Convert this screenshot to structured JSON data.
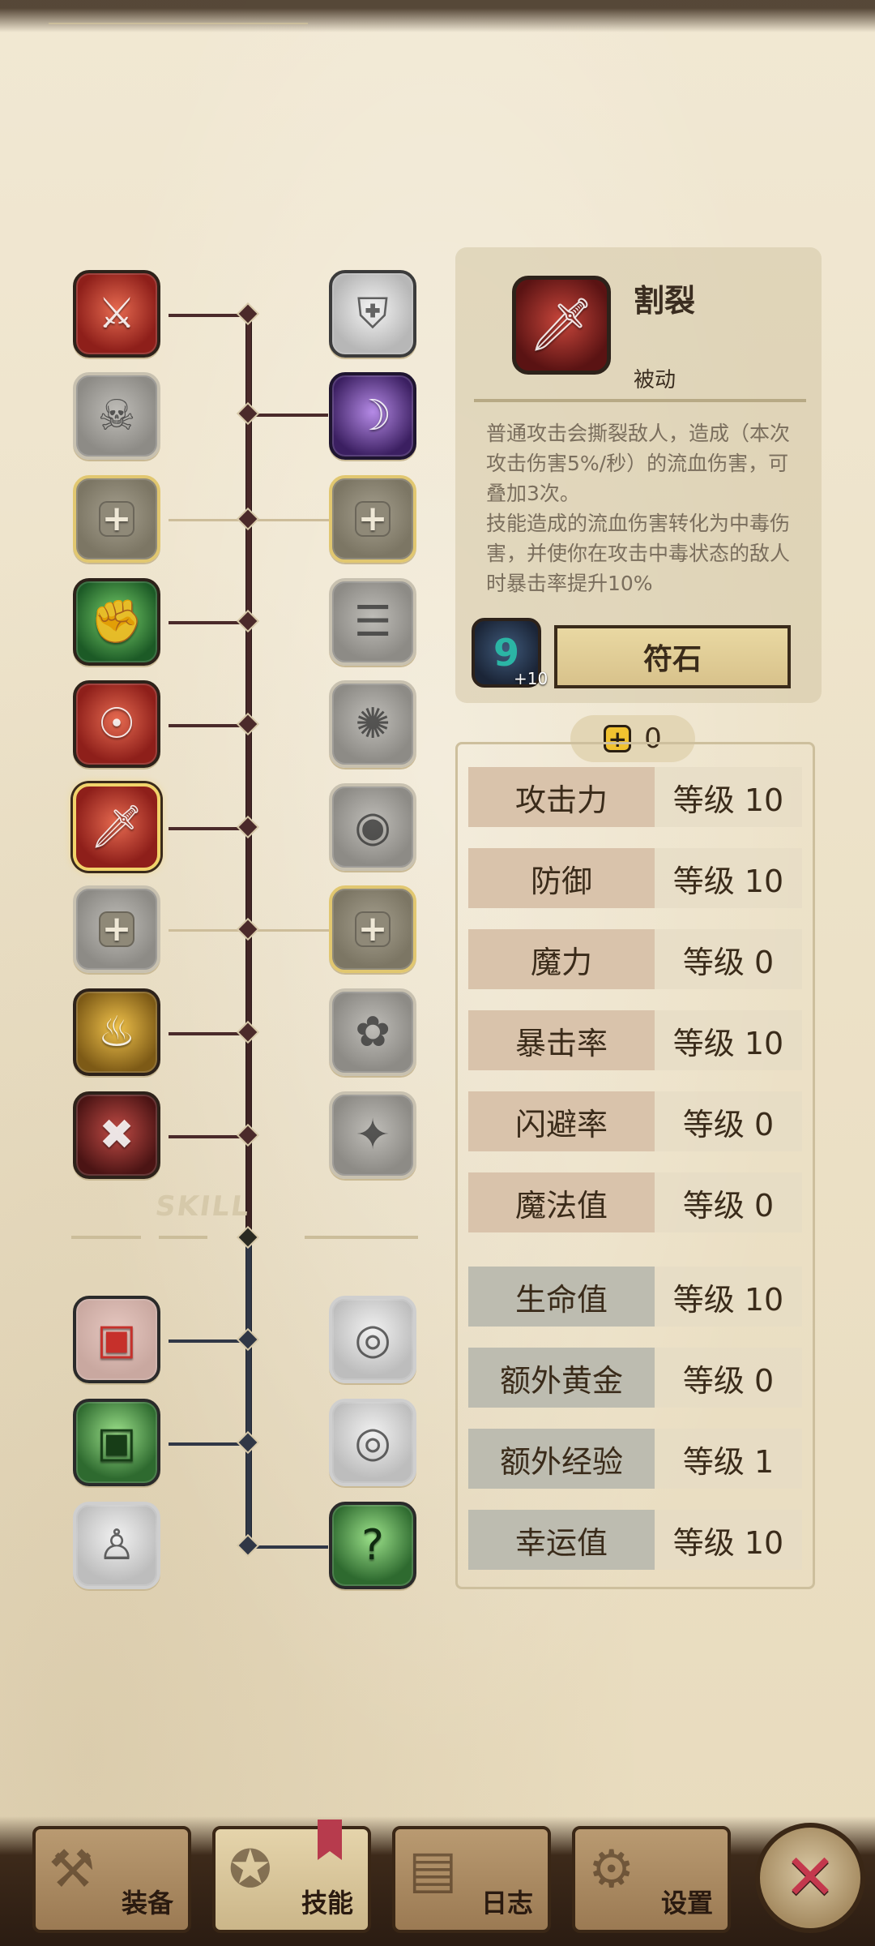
{
  "skill_tree": {
    "section_label": "SKILL",
    "left_column": [
      {
        "name": "slash-skill",
        "icon": "claw-slash-icon",
        "state": "unlocked",
        "color": "red"
      },
      {
        "name": "kick-skill",
        "icon": "kick-icon",
        "state": "locked",
        "color": "gray"
      },
      {
        "name": "empty-slot-left-1",
        "icon": "plus-slot-icon",
        "state": "slot",
        "color": "gold-outline"
      },
      {
        "name": "strength-skill",
        "icon": "muscle-icon",
        "state": "unlocked",
        "color": "green"
      },
      {
        "name": "spin-attack-skill",
        "icon": "spin-attack-icon",
        "state": "unlocked",
        "color": "red"
      },
      {
        "name": "rend-skill",
        "icon": "dagger-icon",
        "state": "selected",
        "color": "red"
      },
      {
        "name": "empty-slot-left-2",
        "icon": "plus-slot-icon",
        "state": "slot",
        "color": "gray"
      },
      {
        "name": "rage-skill",
        "icon": "rage-icon",
        "state": "unlocked",
        "color": "gold"
      },
      {
        "name": "cross-blade-skill",
        "icon": "crossed-swords-icon",
        "state": "unlocked",
        "color": "dark-red"
      }
    ],
    "right_column": [
      {
        "name": "shield-skill",
        "icon": "shield-icon",
        "state": "locked",
        "color": "gray"
      },
      {
        "name": "shadow-skill",
        "icon": "shadow-icon",
        "state": "unlocked",
        "color": "purple"
      },
      {
        "name": "empty-slot-right-1",
        "icon": "plus-slot-icon",
        "state": "slot",
        "color": "gold-outline"
      },
      {
        "name": "charge-skill",
        "icon": "charge-icon",
        "state": "locked",
        "color": "gray"
      },
      {
        "name": "stun-skill",
        "icon": "stun-icon",
        "state": "locked",
        "color": "gray"
      },
      {
        "name": "eye-skill",
        "icon": "eye-icon",
        "state": "locked",
        "color": "gray"
      },
      {
        "name": "empty-slot-right-2",
        "icon": "plus-slot-icon",
        "state": "slot",
        "color": "gold-outline"
      },
      {
        "name": "orb-skill",
        "icon": "orb-icon",
        "state": "locked",
        "color": "gray"
      },
      {
        "name": "sparkle-skill",
        "icon": "sparkle-icon",
        "state": "locked",
        "color": "gray"
      }
    ],
    "lower_left": [
      {
        "name": "lower-skill-1",
        "icon": "red-chest-icon",
        "state": "unlocked",
        "color": "red"
      },
      {
        "name": "lower-skill-2",
        "icon": "green-chest-icon",
        "state": "unlocked",
        "color": "green"
      },
      {
        "name": "lower-skill-3",
        "icon": "ghost-figure-icon",
        "state": "locked",
        "color": "gray"
      }
    ],
    "lower_right": [
      {
        "name": "lower-skill-4",
        "icon": "watch-eye-icon",
        "state": "locked",
        "color": "gray"
      },
      {
        "name": "lower-skill-5",
        "icon": "watch-chest-icon",
        "state": "locked",
        "color": "gray"
      },
      {
        "name": "lower-skill-6",
        "icon": "question-ghost-icon",
        "state": "unlocked",
        "color": "green"
      }
    ]
  },
  "info": {
    "name": "割裂",
    "type": "被动",
    "description": "普通攻击会撕裂敌人，造成（本次攻击伤害5%/秒）的流血伤害，可叠加3次。\n技能造成的流血伤害转化为中毒伤害，并使你在攻击中毒状态的敌人时暴击率提升10%",
    "rune_number": "9",
    "rune_plus": "+10",
    "rune_button": "符石"
  },
  "points": {
    "value": "0"
  },
  "stats": [
    {
      "label": "攻击力",
      "value": "等级 10",
      "group": "attack"
    },
    {
      "label": "防御",
      "value": "等级 10",
      "group": "attack"
    },
    {
      "label": "魔力",
      "value": "等级 0",
      "group": "attack"
    },
    {
      "label": "暴击率",
      "value": "等级 10",
      "group": "attack"
    },
    {
      "label": "闪避率",
      "value": "等级 0",
      "group": "attack"
    },
    {
      "label": "魔法值",
      "value": "等级 0",
      "group": "attack"
    },
    {
      "label": "生命值",
      "value": "等级 10",
      "group": "misc"
    },
    {
      "label": "额外黄金",
      "value": "等级 0",
      "group": "misc"
    },
    {
      "label": "额外经验",
      "value": "等级 1",
      "group": "misc"
    },
    {
      "label": "幸运值",
      "value": "等级 10",
      "group": "misc"
    }
  ],
  "nav": {
    "equipment": "装备",
    "skills": "技能",
    "log": "日志",
    "settings": "设置"
  },
  "colors": {
    "trunk_top": "#4b2a2a",
    "trunk_bottom": "#303746",
    "stat_attack_bg": "#d9c3ab",
    "stat_misc_bg": "#bdbcb0",
    "close_x": "#c4384d"
  }
}
